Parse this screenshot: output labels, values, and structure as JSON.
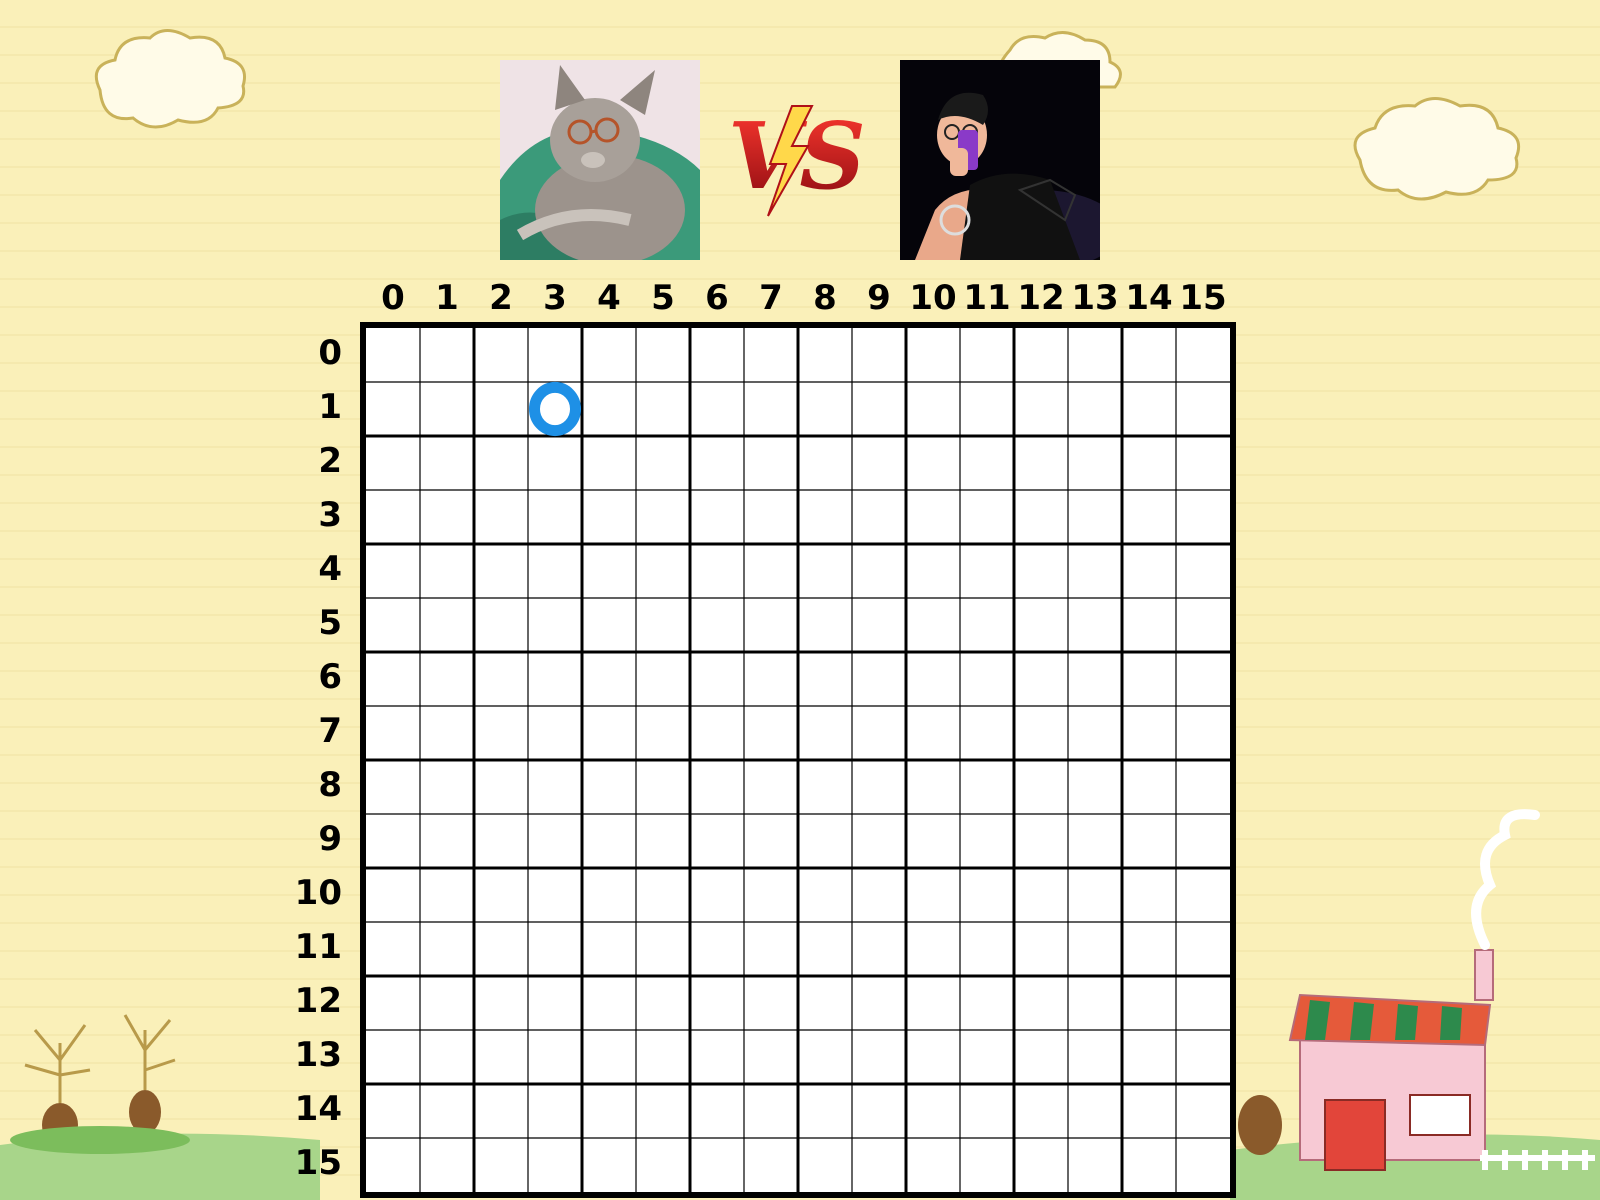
{
  "versus_label": "VS",
  "board": {
    "size": 16,
    "column_labels": [
      "0",
      "1",
      "2",
      "3",
      "4",
      "5",
      "6",
      "7",
      "8",
      "9",
      "10",
      "11",
      "12",
      "13",
      "14",
      "15"
    ],
    "row_labels": [
      "0",
      "1",
      "2",
      "3",
      "4",
      "5",
      "6",
      "7",
      "8",
      "9",
      "10",
      "11",
      "12",
      "13",
      "14",
      "15"
    ],
    "pieces": [
      {
        "row": 1,
        "col": 3,
        "mark": "O",
        "color": "#1e90e6"
      }
    ]
  },
  "players": [
    {
      "name": "cat-with-glasses-avatar"
    },
    {
      "name": "person-taking-selfie-avatar"
    }
  ],
  "colors": {
    "background": "#faf0b9",
    "grid_line": "#000000",
    "piece_o": "#1e90e6",
    "vs_red": "#d0121b"
  }
}
